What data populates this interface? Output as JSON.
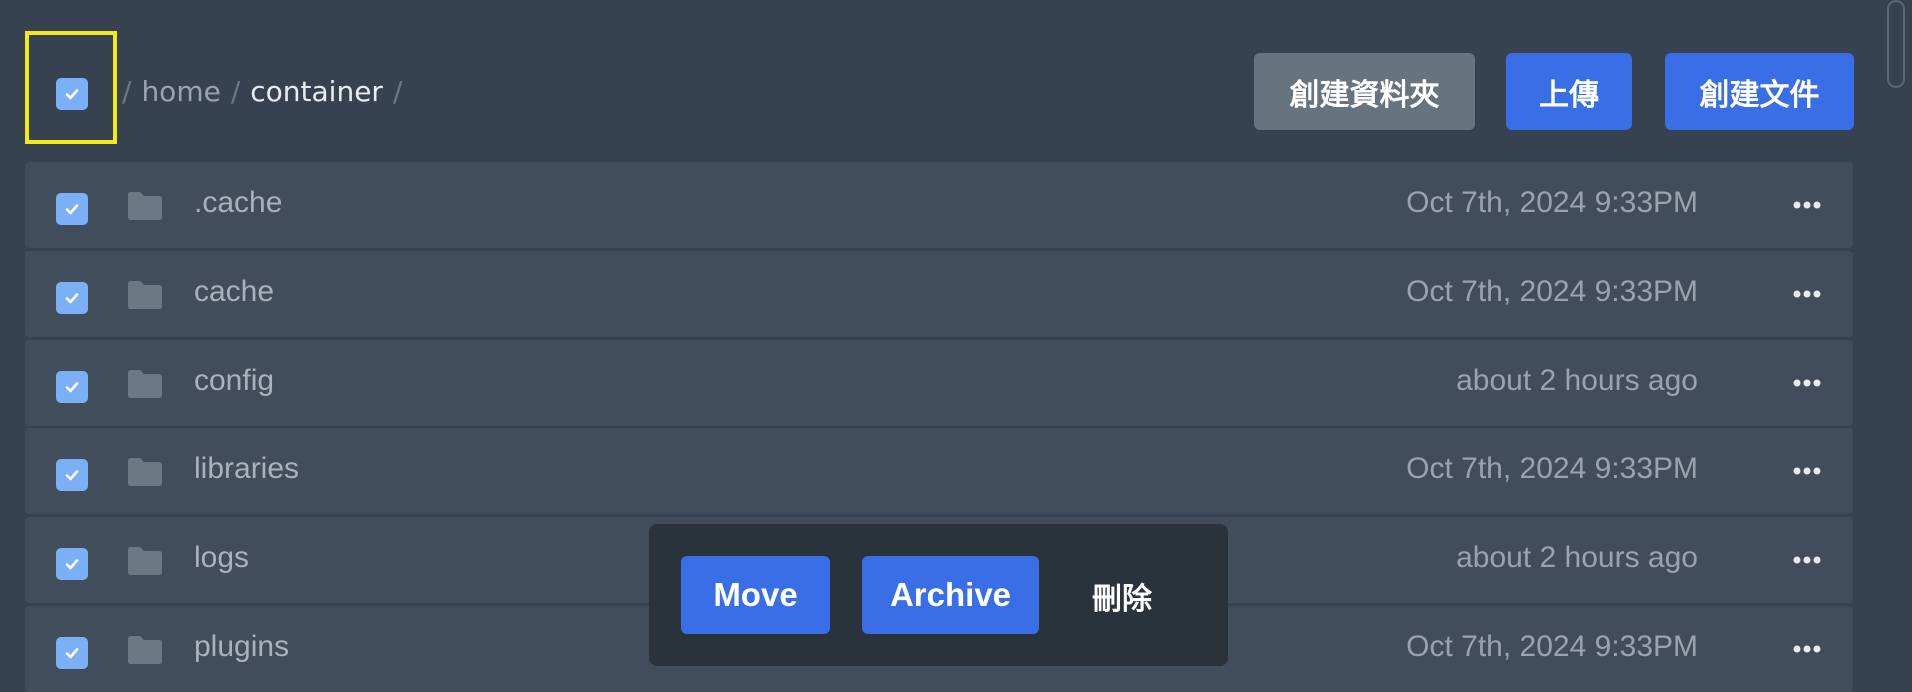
{
  "breadcrumb": {
    "root_sep": "/",
    "items": [
      {
        "label": "home"
      },
      {
        "label": "container"
      }
    ],
    "trailing_sep": "/"
  },
  "toolbar": {
    "create_folder_label": "創建資料夾",
    "upload_label": "上傳",
    "create_file_label": "創建文件"
  },
  "select_all": {
    "checked": true
  },
  "files": [
    {
      "name": ".cache",
      "modified": "Oct 7th, 2024 9:33PM",
      "checked": true,
      "icon": "folder-icon"
    },
    {
      "name": "cache",
      "modified": "Oct 7th, 2024 9:33PM",
      "checked": true,
      "icon": "folder-icon"
    },
    {
      "name": "config",
      "modified": "about 2 hours ago",
      "checked": true,
      "icon": "folder-icon"
    },
    {
      "name": "libraries",
      "modified": "Oct 7th, 2024 9:33PM",
      "checked": true,
      "icon": "folder-icon"
    },
    {
      "name": "logs",
      "modified": "about 2 hours ago",
      "checked": true,
      "icon": "folder-icon"
    },
    {
      "name": "plugins",
      "modified": "Oct 7th, 2024 9:33PM",
      "checked": true,
      "icon": "folder-icon"
    }
  ],
  "bulk_actions": {
    "move_label": "Move",
    "archive_label": "Archive",
    "delete_label": "刪除"
  },
  "colors": {
    "accent": "#3a6ee6",
    "checkbox": "#7cb0f6",
    "highlight": "#f3ea1c",
    "background": "#364250",
    "row": "#414d5a"
  }
}
